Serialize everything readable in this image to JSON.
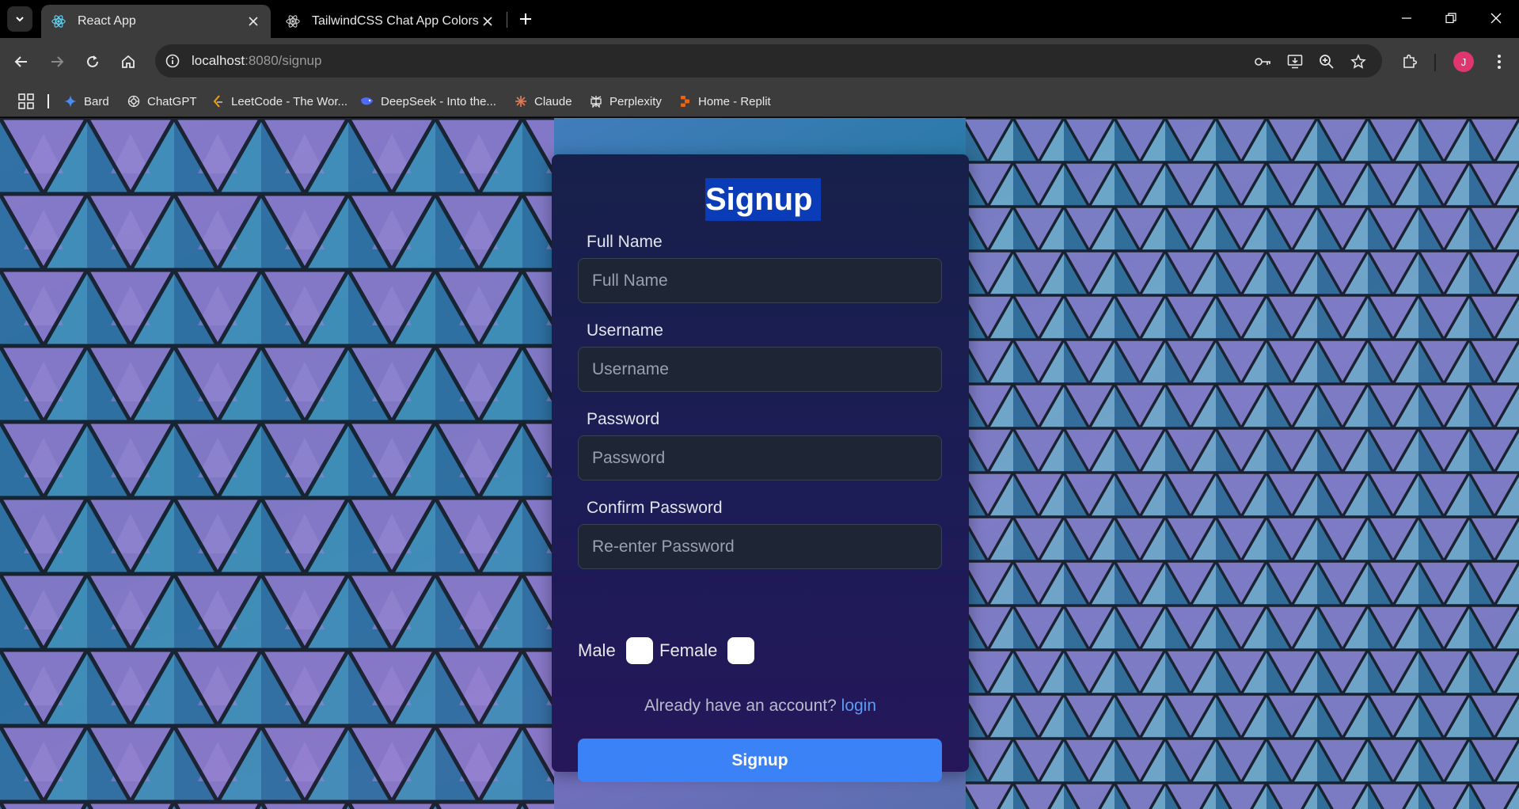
{
  "browser": {
    "tabs": [
      {
        "title": "React App",
        "active": true,
        "icon": "react-icon"
      },
      {
        "title": "TailwindCSS Chat App Colors",
        "active": false,
        "icon": "react-icon"
      }
    ],
    "url": {
      "host": "localhost",
      "path": ":8080/signup"
    },
    "profile_initial": "J",
    "bookmarks": [
      {
        "label": "Bard",
        "icon": "bard-icon"
      },
      {
        "label": "ChatGPT",
        "icon": "chatgpt-icon"
      },
      {
        "label": "LeetCode - The Wor...",
        "icon": "leetcode-icon"
      },
      {
        "label": "DeepSeek - Into the...",
        "icon": "deepseek-icon"
      },
      {
        "label": "Claude",
        "icon": "claude-icon"
      },
      {
        "label": "Perplexity",
        "icon": "perplexity-icon"
      },
      {
        "label": "Home - Replit",
        "icon": "replit-icon"
      }
    ]
  },
  "signup": {
    "title": "Signup",
    "fields": [
      {
        "label": "Full Name",
        "placeholder": "Full Name",
        "value": ""
      },
      {
        "label": "Username",
        "placeholder": "Username",
        "value": ""
      },
      {
        "label": "Password",
        "placeholder": "Password",
        "value": ""
      },
      {
        "label": "Confirm Password",
        "placeholder": "Re-enter Password",
        "value": ""
      }
    ],
    "gender": {
      "male_label": "Male",
      "female_label": "Female",
      "male_checked": false,
      "female_checked": false
    },
    "login_prompt": "Already have an account?",
    "login_link": "login",
    "submit_label": "Signup"
  },
  "colors": {
    "accent": "#3b82f6",
    "link": "#5b9cf5",
    "title_highlight": "#0a3cb8"
  }
}
